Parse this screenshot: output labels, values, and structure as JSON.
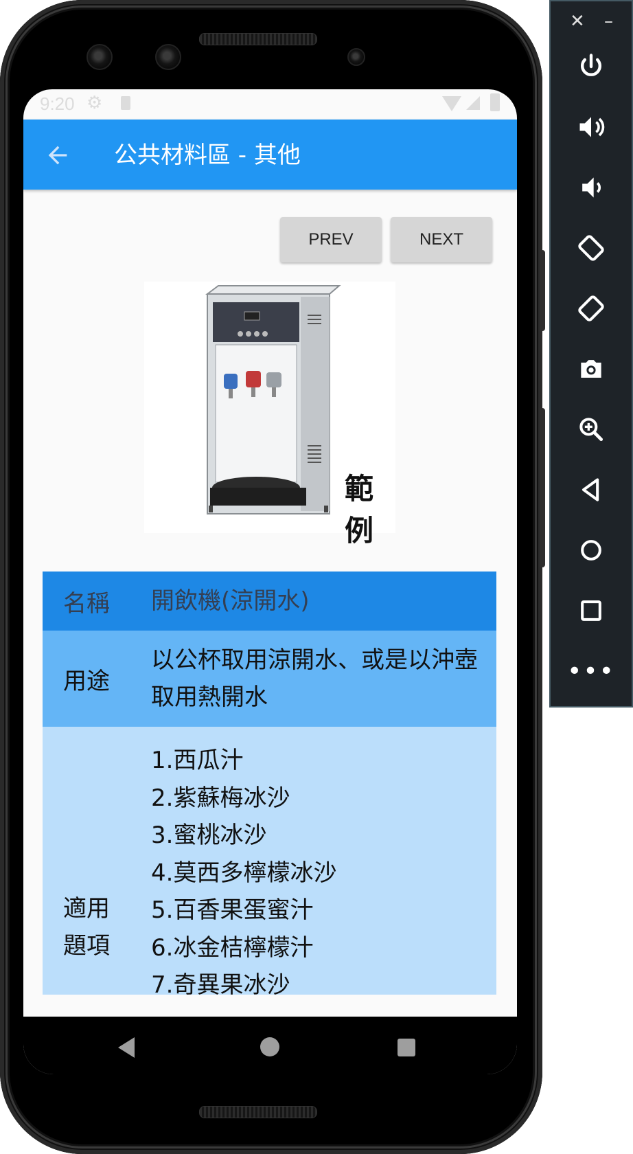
{
  "statusbar": {
    "time": "9:20"
  },
  "appbar": {
    "title": "公共材料區 - 其他"
  },
  "nav_buttons": {
    "prev": "PREV",
    "next": "NEXT"
  },
  "image": {
    "caption": "範例",
    "icon": "water-dispenser-image"
  },
  "table": {
    "name_label": "名稱",
    "name_value": "開飲機(涼開水)",
    "use_label": "用途",
    "use_value": "以公杯取用涼開水、或是以沖壺取用熱開水",
    "items_label": "適用\n題項",
    "items": [
      "1.西瓜汁",
      "2.紫蘇梅冰沙",
      "3.蜜桃冰沙",
      "4.莫西多檸檬冰沙",
      "5.百香果蛋蜜汁",
      "6.冰金桔檸檬汁",
      "7.奇異果冰沙"
    ]
  },
  "colors": {
    "appbar": "#2196f3",
    "row_name": "#1e88e5",
    "row_use": "#64b5f6",
    "row_items": "#bbdefb"
  },
  "emulator": {
    "close": "✕",
    "minimize": "–",
    "more": "•••"
  }
}
